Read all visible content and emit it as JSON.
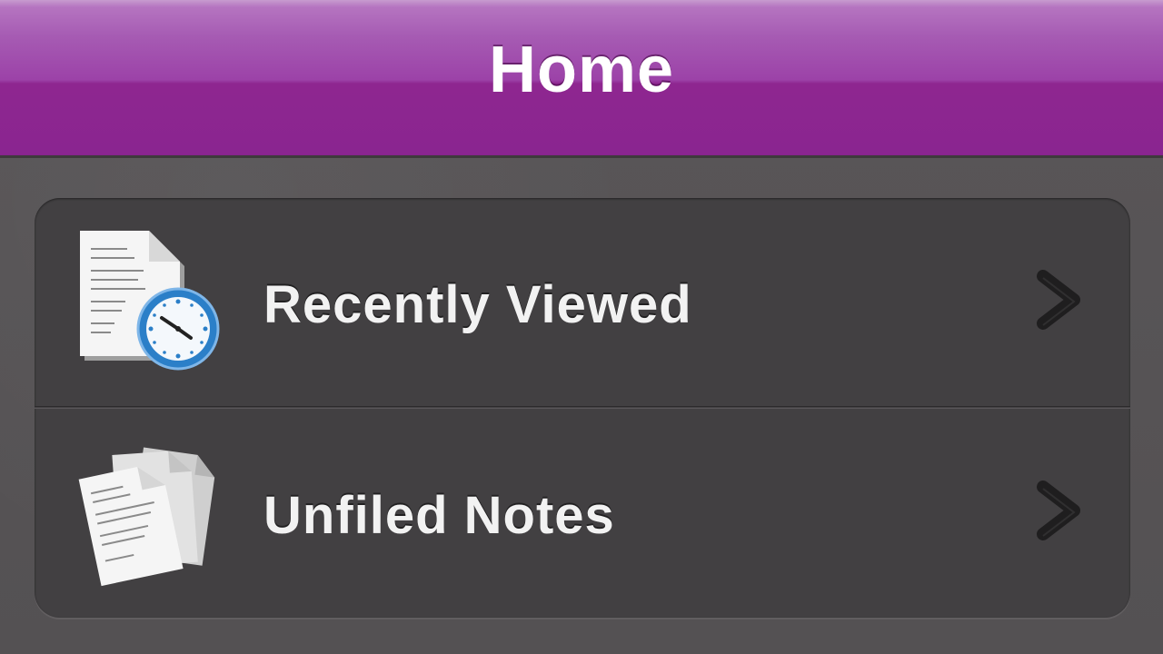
{
  "navbar": {
    "title": "Home"
  },
  "menu": {
    "items": [
      {
        "label": "Recently Viewed",
        "icon": "recent-document-clock-icon"
      },
      {
        "label": "Unfiled Notes",
        "icon": "stacked-notes-icon"
      }
    ]
  },
  "colors": {
    "navbar_purple": "#8a2590",
    "background": "#595658",
    "group_background": "#424042",
    "text": "#f2f2f2"
  }
}
